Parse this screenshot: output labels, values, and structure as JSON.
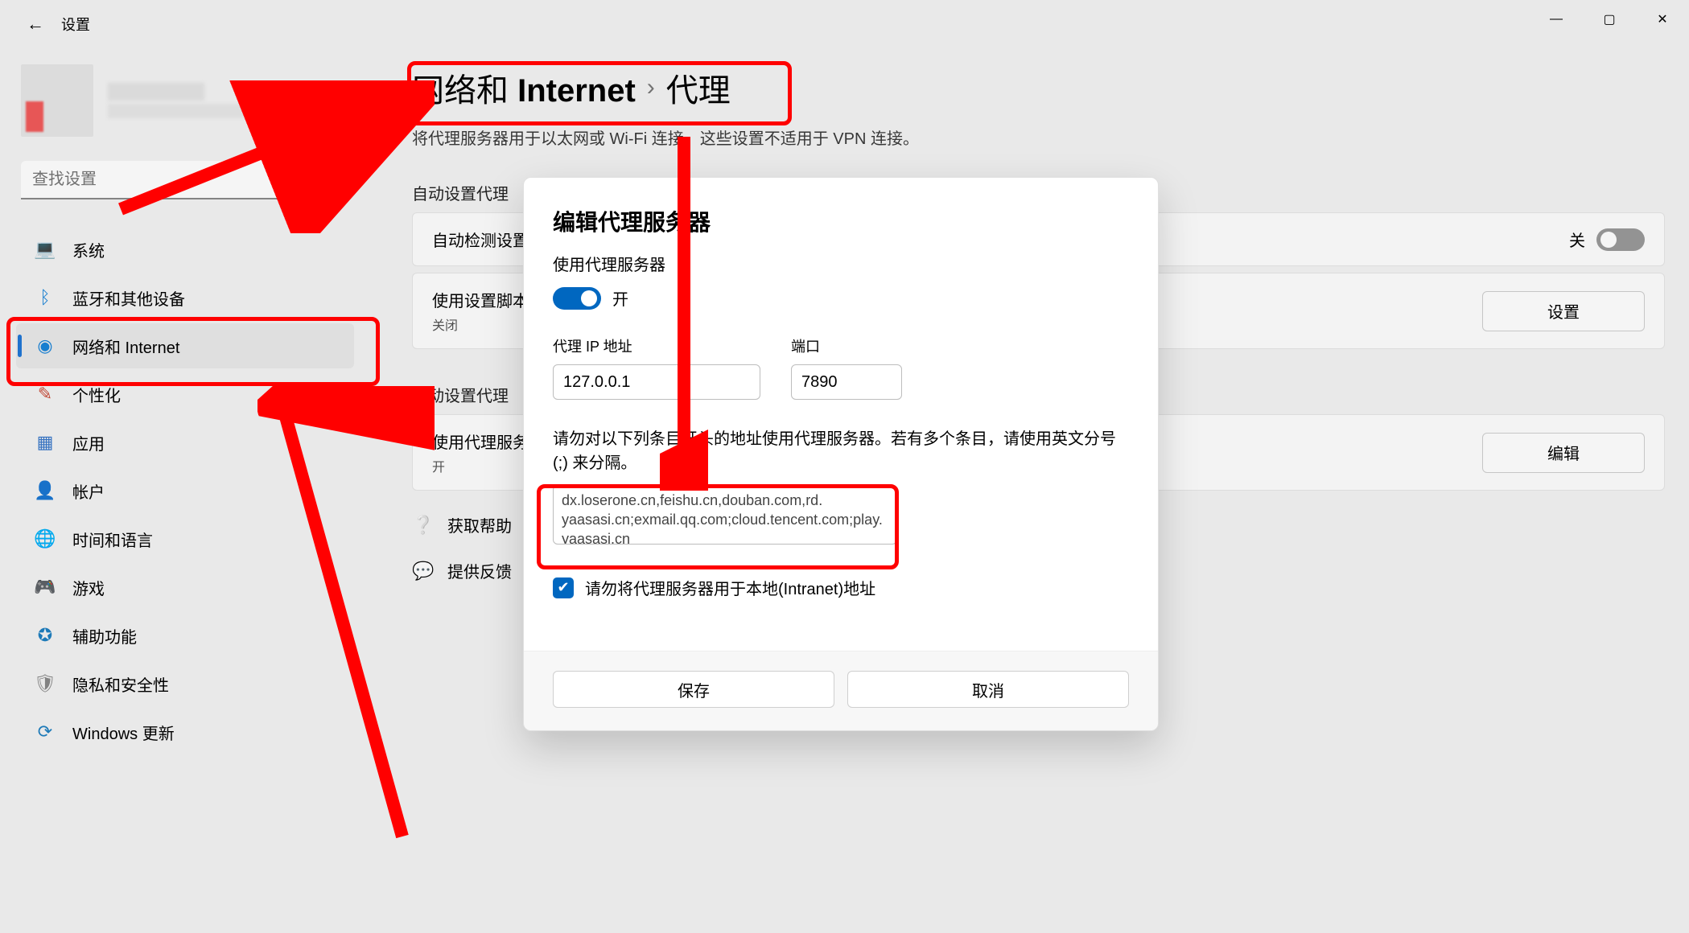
{
  "window": {
    "title": "设置",
    "minimize_glyph": "—",
    "maximize_glyph": "▢",
    "close_glyph": "✕",
    "back_glyph": "←"
  },
  "search": {
    "placeholder": "查找设置"
  },
  "sidebar": {
    "items": [
      {
        "icon": "💻",
        "icon_name": "system-icon",
        "label": "系统"
      },
      {
        "icon": "ᛒ",
        "icon_name": "bluetooth-icon",
        "label": "蓝牙和其他设备",
        "icon_color": "#1a84d8"
      },
      {
        "icon": "◉",
        "icon_name": "wifi-icon",
        "label": "网络和 Internet",
        "icon_color": "#1a84d8",
        "selected": true
      },
      {
        "icon": "✎",
        "icon_name": "brush-icon",
        "label": "个性化",
        "icon_color": "#c94d3a"
      },
      {
        "icon": "▦",
        "icon_name": "apps-icon",
        "label": "应用",
        "icon_color": "#3a78c9"
      },
      {
        "icon": "👤",
        "icon_name": "person-icon",
        "label": "帐户",
        "icon_color": "#3a78c9"
      },
      {
        "icon": "🌐",
        "icon_name": "globe-clock-icon",
        "label": "时间和语言",
        "icon_color": "#2f6fb5"
      },
      {
        "icon": "🎮",
        "icon_name": "gamepad-icon",
        "label": "游戏",
        "icon_color": "#888"
      },
      {
        "icon": "✪",
        "icon_name": "accessibility-icon",
        "label": "辅助功能",
        "icon_color": "#1f7fc0"
      },
      {
        "icon": "🛡",
        "icon_name": "shield-icon",
        "label": "隐私和安全性",
        "icon_color": "#888"
      },
      {
        "icon": "⟳",
        "icon_name": "update-icon",
        "label": "Windows 更新",
        "icon_color": "#1f7fc0"
      }
    ]
  },
  "breadcrumb": {
    "parent": "网络和 Internet",
    "sep": "›",
    "current": "代理"
  },
  "subtitle": "将代理服务器用于以太网或 Wi-Fi 连接。这些设置不适用于 VPN 连接。",
  "auto_section": {
    "heading": "自动设置代理"
  },
  "auto_card": {
    "title": "自动检测设置",
    "state_label": "关",
    "switch_on": false
  },
  "script_card": {
    "title": "使用设置脚本",
    "subtitle": "关闭",
    "button": "设置"
  },
  "manual_section": {
    "heading": "手动设置代理"
  },
  "manual_card": {
    "title": "使用代理服务器",
    "subtitle": "开",
    "button": "编辑"
  },
  "links": {
    "help": "获取帮助",
    "feedback": "提供反馈"
  },
  "dialog": {
    "title": "编辑代理服务器",
    "use_label": "使用代理服务器",
    "toggle_label": "开",
    "ip_label": "代理 IP 地址",
    "ip_value": "127.0.0.1",
    "port_label": "端口",
    "port_value": "7890",
    "hint": "请勿对以下列条目开头的地址使用代理服务器。若有多个条目，请使用英文分号(;) 来分隔。",
    "exclude_line0": "dx.loserone.cn,feishu.cn,douban.com,rd.",
    "exclude_value": "yaasasi.cn;exmail.qq.com;cloud.tencent.com;play.yaasasi.cn",
    "intranet_checked": true,
    "intranet_label": "请勿将代理服务器用于本地(Intranet)地址",
    "save": "保存",
    "cancel": "取消"
  }
}
